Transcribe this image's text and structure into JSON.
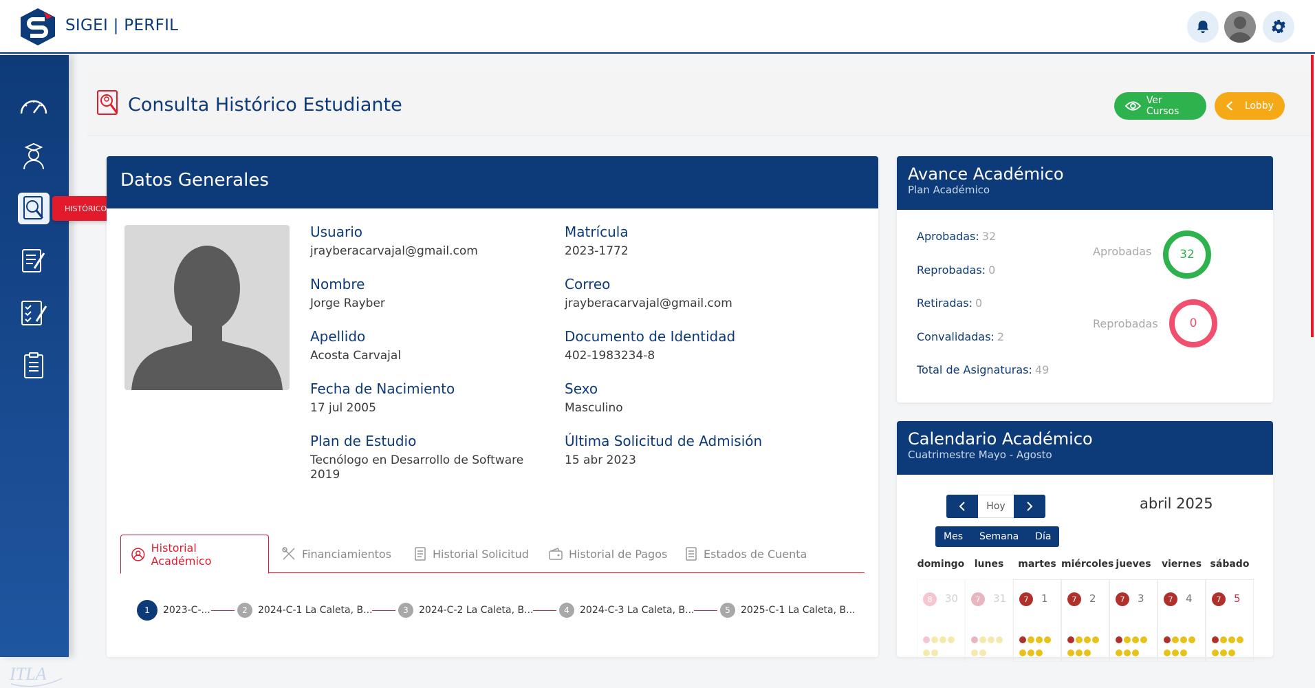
{
  "header": {
    "app_title": "SIGEI | PERFIL"
  },
  "sidebar": {
    "tooltip": "HISTÓRICO ESTUDIANTIL",
    "items": [
      {
        "icon": "speedometer-icon"
      },
      {
        "icon": "student-icon"
      },
      {
        "icon": "student-search-icon"
      },
      {
        "icon": "document-edit-icon"
      },
      {
        "icon": "checklist-icon"
      },
      {
        "icon": "clipboard-icon"
      }
    ],
    "footer_logo": "ITLA"
  },
  "page": {
    "title": "Consulta Histórico Estudiante",
    "btn_ver_cursos": "Ver Cursos",
    "btn_lobby": "Lobby"
  },
  "general": {
    "title": "Datos Generales",
    "fields": {
      "usuario_label": "Usuario",
      "usuario_value": "jrayberacarvajal@gmail.com",
      "matricula_label": "Matrícula",
      "matricula_value": "2023-1772",
      "nombre_label": "Nombre",
      "nombre_value": "Jorge Rayber",
      "correo_label": "Correo",
      "correo_value": "jrayberacarvajal@gmail.com",
      "apellido_label": "Apellido",
      "apellido_value": "Acosta Carvajal",
      "documento_label": "Documento de Identidad",
      "documento_value": "402-1983234-8",
      "nacimiento_label": "Fecha de Nacimiento",
      "nacimiento_value": "17 jul 2005",
      "sexo_label": "Sexo",
      "sexo_value": "Masculino",
      "plan_label": "Plan de Estudio",
      "plan_value": "Tecnólogo en Desarrollo de Software 2019",
      "admision_label": "Última Solicitud de Admisión",
      "admision_value": "15 abr 2023"
    },
    "tabs": [
      {
        "label": "Historial Académico",
        "active": true
      },
      {
        "label": "Financiamientos"
      },
      {
        "label": "Historial Solicitud"
      },
      {
        "label": "Historial de Pagos"
      },
      {
        "label": "Estados de Cuenta"
      }
    ],
    "steps": [
      {
        "num": "1",
        "label": "2023-C-..."
      },
      {
        "num": "2",
        "label": "2024-C-1 La Caleta, B..."
      },
      {
        "num": "3",
        "label": "2024-C-2 La Caleta, B..."
      },
      {
        "num": "4",
        "label": "2024-C-3 La Caleta, B..."
      },
      {
        "num": "5",
        "label": "2025-C-1 La Caleta, B..."
      }
    ]
  },
  "avance": {
    "title": "Avance Académico",
    "subtitle": "Plan Académico",
    "stats": [
      {
        "label": "Aprobadas:",
        "value": "32"
      },
      {
        "label": "Reprobadas:",
        "value": "0"
      },
      {
        "label": "Retiradas:",
        "value": "0"
      },
      {
        "label": "Convalidadas:",
        "value": "2"
      },
      {
        "label": "Total de Asignaturas:",
        "value": "49"
      }
    ],
    "ring_aprobadas_label": "Aprobadas",
    "ring_aprobadas_value": "32",
    "ring_reprobadas_label": "Reprobadas",
    "ring_reprobadas_value": "0",
    "colors": {
      "approved": "#2eb24d",
      "failed": "#f0506e"
    }
  },
  "calendar": {
    "title": "Calendario Académico",
    "subtitle": "Cuatrimestre Mayo - Agosto",
    "today_label": "Hoy",
    "views": [
      "Mes",
      "Semana",
      "Día"
    ],
    "month": "abril 2025",
    "weekdays": [
      "domingo",
      "lunes",
      "martes",
      "miércoles",
      "jueves",
      "viernes",
      "sábado"
    ],
    "days": [
      {
        "badge": "8",
        "num": "30",
        "muted": true
      },
      {
        "badge": "7",
        "num": "31",
        "muted": true
      },
      {
        "badge": "7",
        "num": "1"
      },
      {
        "badge": "7",
        "num": "2"
      },
      {
        "badge": "7",
        "num": "3"
      },
      {
        "badge": "7",
        "num": "4"
      },
      {
        "badge": "7",
        "num": "5"
      }
    ]
  }
}
